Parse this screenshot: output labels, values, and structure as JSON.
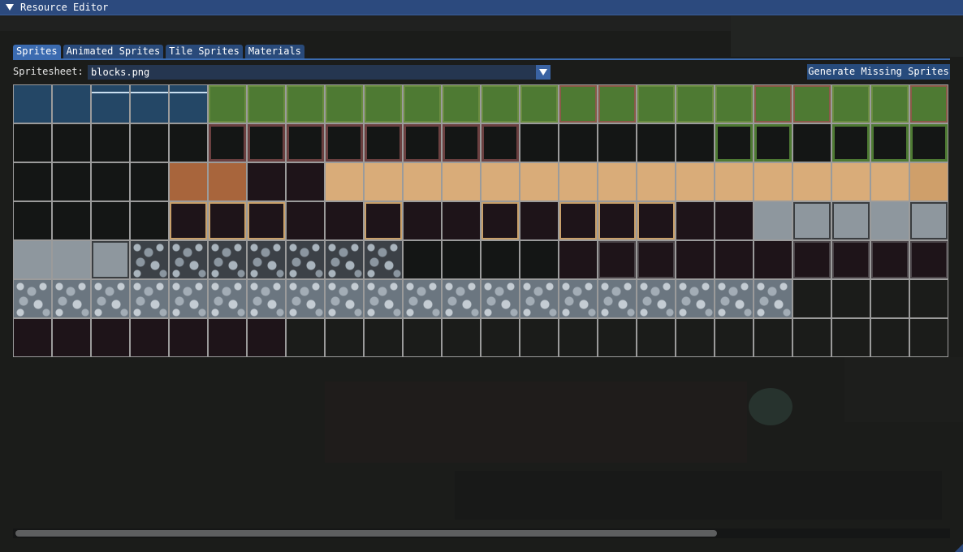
{
  "window": {
    "title": "Resource Editor"
  },
  "tabs": [
    {
      "label": "Sprites",
      "active": true
    },
    {
      "label": "Animated Sprites",
      "active": false
    },
    {
      "label": "Tile Sprites",
      "active": false
    },
    {
      "label": "Materials",
      "active": false
    }
  ],
  "spritesheet": {
    "label": "Spritesheet:",
    "selected": "blocks.png"
  },
  "generate_button": {
    "label": "Generate Missing Sprites"
  },
  "sprite_grid": {
    "columns": 24,
    "rows": [
      [
        "water",
        "water",
        "water-top",
        "water-top",
        "water-top",
        "grass",
        "grass",
        "grass",
        "grass",
        "grass",
        "grass",
        "grass",
        "grass",
        "grass",
        "grass-dirt",
        "grass-dirt",
        "grass",
        "grass",
        "grass",
        "grass-dirt",
        "grass-dirt",
        "grass",
        "grass",
        "grass-dirt"
      ],
      [
        "dark",
        "dark",
        "dark",
        "dark",
        "dark",
        "dark-dirtedge",
        "dark-dirtedge",
        "dark-dirtedge",
        "dark-dirtedge",
        "dark-dirtedge",
        "dark-dirtedge",
        "dark-dirtedge",
        "dark-dirtedge",
        "dark",
        "dark",
        "dark",
        "dark",
        "dark",
        "dark-green",
        "dark-green",
        "dark",
        "dark-green",
        "dark-green",
        "dark-green"
      ],
      [
        "dark",
        "dark",
        "dark",
        "dark",
        "dirt",
        "dirt",
        "maroon",
        "maroon",
        "sand",
        "sand",
        "sand",
        "sand",
        "sand",
        "sand",
        "sand",
        "sand",
        "sand",
        "sand",
        "sand",
        "sand",
        "sand",
        "sand",
        "sand",
        "sand-speck"
      ],
      [
        "dark",
        "dark",
        "dark",
        "dark",
        "maroon-sand",
        "maroon-sand",
        "maroon-sand",
        "maroon",
        "maroon",
        "maroon-sand",
        "maroon",
        "maroon",
        "maroon-sand",
        "maroon",
        "maroon-sand",
        "maroon-sand",
        "maroon-sand",
        "maroon",
        "maroon",
        "stone",
        "stone-dash",
        "stone-dash",
        "stone",
        "stone-dash"
      ],
      [
        "stone",
        "stone",
        "stone-dash",
        "cobble",
        "cobble",
        "cobble",
        "cobble",
        "cobble",
        "cobble",
        "cobble",
        "dark",
        "dark",
        "dark",
        "dark",
        "maroon",
        "maroon-dash",
        "maroon-dash",
        "maroon",
        "maroon",
        "maroon",
        "maroon-dash",
        "maroon-dash",
        "maroon-dash",
        "maroon-dash"
      ],
      [
        "cobble-light",
        "cobble-light",
        "cobble-light",
        "cobble-light",
        "cobble-light",
        "cobble-light",
        "cobble-light",
        "cobble-light",
        "cobble-light",
        "cobble-light",
        "cobble-light",
        "cobble-light",
        "cobble-light",
        "cobble-light",
        "cobble-light",
        "cobble-light",
        "cobble-light",
        "cobble-light",
        "cobble-light",
        "cobble-light",
        "empty",
        "empty",
        "empty",
        "empty"
      ],
      [
        "maroon",
        "maroon",
        "maroon",
        "maroon",
        "maroon",
        "maroon",
        "maroon",
        "empty",
        "empty",
        "empty",
        "empty",
        "empty",
        "empty",
        "empty",
        "empty",
        "empty",
        "empty",
        "empty",
        "empty",
        "empty",
        "empty",
        "empty",
        "empty",
        "empty"
      ]
    ]
  },
  "colors": {
    "title_bar": "#2c4a7e",
    "tab_active": "#3b6bb0",
    "tab_inactive": "#294a7a",
    "grid_line": "#9b9b9b"
  },
  "icons": {
    "collapse": "triangle-down-icon",
    "dropdown": "chevron-down-icon"
  }
}
